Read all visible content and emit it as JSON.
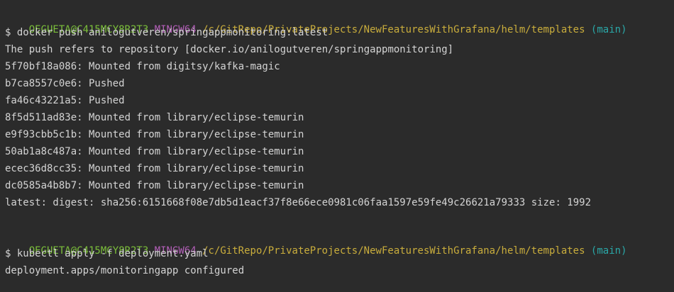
{
  "colors": {
    "background": "#2b2b2b",
    "text": "#d4d4d4",
    "user_host": "#7bbf3a",
    "mingw": "#b35fb8",
    "path": "#c9ad3c",
    "branch": "#2aa8a8"
  },
  "blocks": [
    {
      "prompt": {
        "user_host": "OEGUETA@C415MCY8R2T3",
        "env": "MINGW64",
        "path": "/c/GitRepo/PrivateProjects/NewFeaturesWithGrafana/helm/templates",
        "branch": "(main)"
      },
      "command": "$ docker push anilogutveren/springappmonitoring:latest",
      "output": [
        "The push refers to repository [docker.io/anilogutveren/springappmonitoring]",
        "5f70bf18a086: Mounted from digitsy/kafka-magic",
        "b7ca8557c0e6: Pushed",
        "fa46c43221a5: Pushed",
        "8f5d511ad83e: Mounted from library/eclipse-temurin",
        "e9f93cbb5c1b: Mounted from library/eclipse-temurin",
        "50ab1a8c487a: Mounted from library/eclipse-temurin",
        "ecec36d8cc35: Mounted from library/eclipse-temurin",
        "dc0585a4b8b7: Mounted from library/eclipse-temurin",
        "latest: digest: sha256:6151668f08e7db5d1eacf37f8e66ece0981c06faa1597e59fe49c26621a79333 size: 1992"
      ]
    },
    {
      "prompt": {
        "user_host": "OEGUETA@C415MCY8R2T3",
        "env": "MINGW64",
        "path": "/c/GitRepo/PrivateProjects/NewFeaturesWithGrafana/helm/templates",
        "branch": "(main)"
      },
      "command": "$ kubectl apply -f deployment.yaml",
      "output": [
        "deployment.apps/monitoringapp configured"
      ]
    }
  ]
}
